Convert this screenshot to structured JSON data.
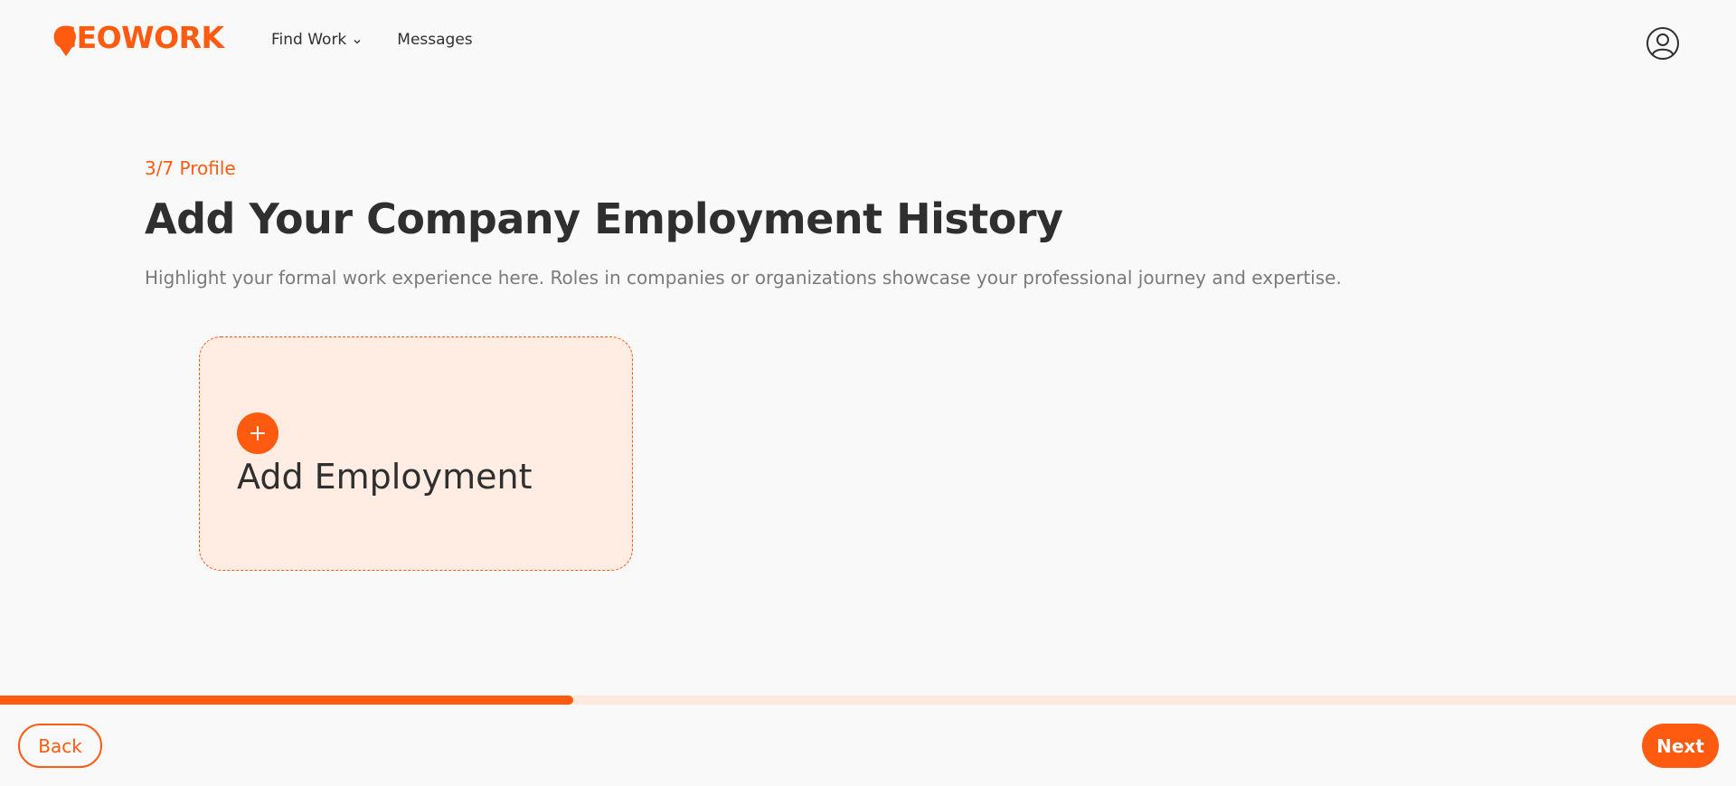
{
  "brand": {
    "logo_text": "GEOWORK",
    "accent_color": "#fe5a10"
  },
  "nav": {
    "items": [
      {
        "label": "Find Work",
        "has_dropdown": true,
        "icon": "chevron-down-icon"
      },
      {
        "label": "Messages",
        "has_dropdown": false
      }
    ],
    "profile_icon": "user-circle-icon"
  },
  "step": {
    "label": "3/7 Profile",
    "current": 3,
    "total": 7
  },
  "heading": {
    "title": "Add Your Company Employment History",
    "subtitle": "Highlight your formal work experience here. Roles in companies or organizations showcase your professional journey and expertise."
  },
  "add_card": {
    "label": "Add Employment",
    "icon": "plus-icon"
  },
  "progress": {
    "fraction": 0.33
  },
  "footer": {
    "back_label": "Back",
    "next_label": "Next"
  }
}
